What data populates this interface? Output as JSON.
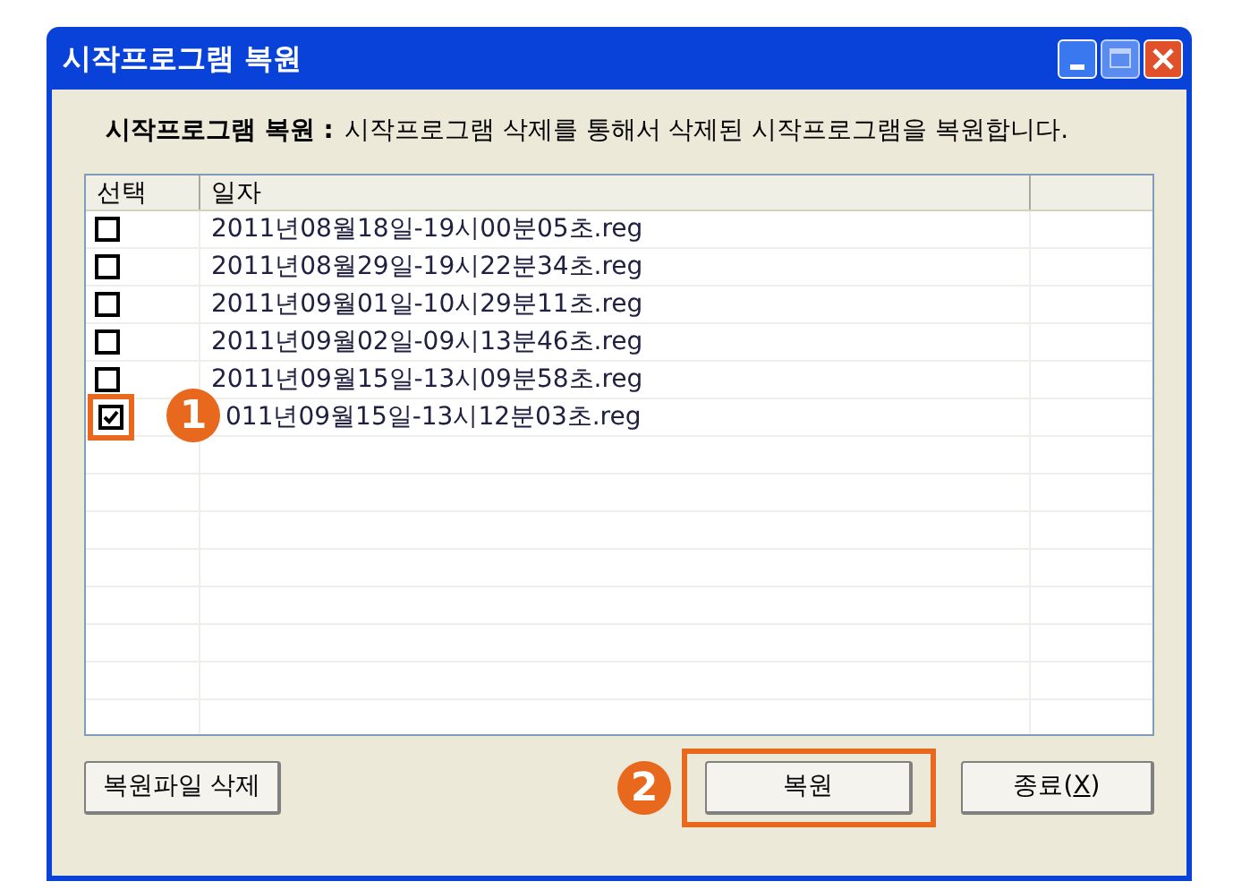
{
  "window": {
    "title": "시작프로그램 복원"
  },
  "description": {
    "label": "시작프로그램 복원 :",
    "text": "시작프로그램 삭제를 통해서 삭제된 시작프로그램을 복원합니다."
  },
  "table": {
    "columns": [
      "선택",
      "일자"
    ],
    "rows": [
      {
        "checked": false,
        "date": "2011년08월18일-19시00분05초.reg"
      },
      {
        "checked": false,
        "date": "2011년08월29일-19시22분34초.reg"
      },
      {
        "checked": false,
        "date": "2011년09월01일-10시29분11초.reg"
      },
      {
        "checked": false,
        "date": "2011년09월02일-09시13분46초.reg"
      },
      {
        "checked": false,
        "date": "2011년09월15일-13시09분58초.reg"
      },
      {
        "checked": true,
        "date": "011년09월15일-13시12분03초.reg"
      }
    ]
  },
  "buttons": [
    {
      "label": "복원파일 삭제",
      "highlighted": false
    },
    {
      "label": "복원",
      "highlighted": true,
      "callout": "2"
    },
    {
      "label_before": "종료(",
      "mnemonic": "X",
      "label_after": ")",
      "highlighted": false
    }
  ],
  "callouts": [
    {
      "number": "1"
    }
  ]
}
